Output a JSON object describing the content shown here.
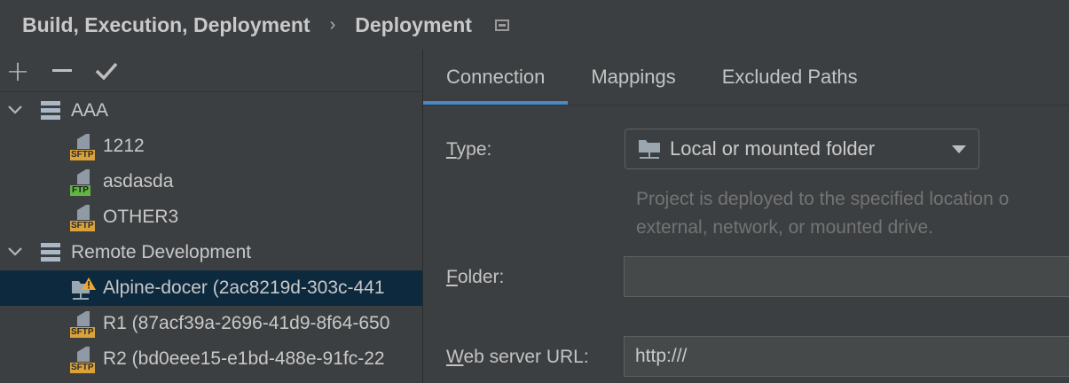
{
  "header": {
    "breadcrumb_parent": "Build, Execution, Deployment",
    "separator": "›",
    "breadcrumb_current": "Deployment",
    "icon": "window-icon"
  },
  "toolbar": {
    "add_label": "+",
    "add_icon": "plus-icon",
    "remove_icon": "minus-icon",
    "default_icon": "check-icon"
  },
  "tree": {
    "groups": [
      {
        "label": "AAA",
        "children": [
          {
            "label": "1212",
            "protocol": "SFTP"
          },
          {
            "label": "asdasda",
            "protocol": "FTP"
          },
          {
            "label": "OTHER3",
            "protocol": "SFTP"
          }
        ]
      },
      {
        "label": "Remote Development",
        "children": [
          {
            "label": "Alpine-docer (2ac8219d-303c-441",
            "protocol": "local-warning"
          },
          {
            "label": "R1 (87acf39a-2696-41d9-8f64-650",
            "protocol": "SFTP"
          },
          {
            "label": "R2 (bd0eee15-e1bd-488e-91fc-22",
            "protocol": "SFTP"
          }
        ]
      }
    ]
  },
  "tabs": [
    {
      "label": "Connection",
      "active": true
    },
    {
      "label": "Mappings",
      "active": false
    },
    {
      "label": "Excluded Paths",
      "active": false
    }
  ],
  "form": {
    "type_label_mnemonic": "T",
    "type_label_rest": "ype:",
    "type_value": "Local or mounted folder",
    "type_hint_line1": "Project is deployed to the specified location o",
    "type_hint_line2": "external, network, or mounted drive.",
    "folder_label_mnemonic": "F",
    "folder_label_rest": "older:",
    "folder_value": "",
    "web_url_label_mnemonic": "W",
    "web_url_label_rest": "eb server URL:",
    "web_url_value": "http:///"
  },
  "colors": {
    "background": "#3c3f41",
    "selection": "#0d293e",
    "tab_underline": "#4a88c7",
    "sftp_badge": "#d9a23a",
    "ftp_badge": "#62b543"
  }
}
